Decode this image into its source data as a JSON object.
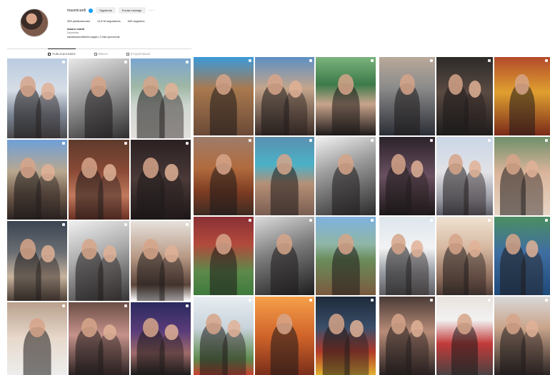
{
  "profile": {
    "username": "mauroicardi",
    "verified_icon": "verified-badge-icon",
    "follow_label": "Siguiendo",
    "message_label": "Enviar mensaje",
    "more_label": "···",
    "stats": {
      "posts": "383 publicaciones",
      "followers": "11,8 M seguidores",
      "following": "540 seguidos"
    },
    "name": "mauro icardi",
    "category": "Deportista",
    "bio": "wandanaracollection.pages | 2 links oprovechar"
  },
  "tabs": [
    {
      "label": "PUBLICACIONES",
      "icon": "grid-icon",
      "active": true
    },
    {
      "label": "REELS",
      "icon": "reels-icon",
      "active": false
    },
    {
      "label": "ETIQUETADAS",
      "icon": "tagged-icon",
      "active": false
    }
  ],
  "colors": {
    "accent": "#0095f6",
    "border": "#dbdbdb",
    "button_bg": "#efefef"
  },
  "grid_a": [
    {
      "bg": "linear-gradient(180deg,#b9cbe0 0%,#d7dde6 40%,#7d8794 70%,#4b4a4d 100%)",
      "people": 2
    },
    {
      "bg": "linear-gradient(160deg,#e8e8e8 0%,#9a9a9a 45%,#2e2e2e 100%)",
      "people": 1
    },
    {
      "bg": "linear-gradient(180deg,#7aa6d1 0%,#9fb7a5 35%,#cfd6d0 60%,#e3e0dc 100%)",
      "people": 2
    },
    {
      "bg": "linear-gradient(180deg,#6fa0d8 0%,#b9a78e 40%,#6e5a4b 70%,#2c2522 100%)",
      "people": 2
    },
    {
      "bg": "linear-gradient(180deg,#5d3b2c 0%,#8a4a36 40%,#c27a5d 70%,#6a2f22 100%)",
      "people": 2
    },
    {
      "bg": "linear-gradient(180deg,#2b2022 0%,#4a3a38 50%,#1c1617 100%)",
      "people": 2
    },
    {
      "bg": "linear-gradient(180deg,#3a4552 0%,#6b6f73 40%,#c8b39d 70%,#4c3f37 100%)",
      "people": 2
    },
    {
      "bg": "linear-gradient(160deg,#f0f0f0 0%,#a8a8a8 45%,#353535 100%)",
      "people": 2
    },
    {
      "bg": "linear-gradient(180deg,#e6e1dc 0%,#b89985 45%,#5a443a 80%,#ffffff 100%)",
      "people": 2
    },
    {
      "bg": "linear-gradient(180deg,#b9a08c 0%,#e7d9cc 50%,#ededed 100%)",
      "people": 1
    },
    {
      "bg": "linear-gradient(180deg,#6b4e45 0%,#c5928a 45%,#2d2323 100%)",
      "people": 2
    },
    {
      "bg": "linear-gradient(180deg,#2a2a5e 0%,#5b3c7a 40%,#a06a6a 70%,#1b1b1b 100%)",
      "people": 2
    }
  ],
  "grid_b": [
    {
      "bg": "linear-gradient(180deg,#3a9ad9 0%,#a9794f 40%,#6b4a37 100%)",
      "people": 1
    },
    {
      "bg": "linear-gradient(180deg,#5d8fc4 0%,#c4a58b 40%,#3a2c28 100%)",
      "people": 2
    },
    {
      "bg": "linear-gradient(180deg,#7bb37c 0%,#3d7a4a 35%,#c8a48c 60%,#1f1a1a 100%)",
      "people": 1
    },
    {
      "bg": "linear-gradient(180deg,#9d7c6a 0%,#b26b3e 40%,#7d3c22 70%,#3c2a22 100%)",
      "people": 1
    },
    {
      "bg": "linear-gradient(180deg,#5b8fb0 0%,#4bb1c7 35%,#b58f76 60%,#7a5e52 100%)",
      "people": 1
    },
    {
      "bg": "linear-gradient(160deg,#f2f2f2 0%,#9b9b9b 40%,#2b2b2b 100%)",
      "people": 1
    },
    {
      "bg": "linear-gradient(180deg,#8a2f35 0%,#b24a3c 35%,#5c8a4b 70%,#3f7a3d 100%)",
      "people": 1
    },
    {
      "bg": "linear-gradient(160deg,#dcdcdc 0%,#7a7a7a 45%,#1e1e1e 100%)",
      "people": 1
    },
    {
      "bg": "linear-gradient(180deg,#7fb2e0 0%,#8fb6a6 35%,#6a8c5a 55%,#7a5a3e 100%)",
      "people": 1
    },
    {
      "bg": "linear-gradient(180deg,#e8eef2 0%,#c9d3db 40%,#5d8a4d 80%,#c9402f 100%)",
      "people": 2
    },
    {
      "bg": "linear-gradient(180deg,#f5a04a 0%,#d1642a 50%,#7a2e1a 100%)",
      "people": 1
    },
    {
      "bg": "linear-gradient(180deg,#1e2a3a 0%,#3a4f6a 40%,#b23a2a 70%,#e0b030 100%)",
      "people": 2
    }
  ],
  "grid_c": [
    {
      "bg": "linear-gradient(180deg,#b9a99a 0%,#8a8a8a 40%,#2c2e36 100%)",
      "people": 1
    },
    {
      "bg": "linear-gradient(180deg,#2c2a28 0%,#5a4a42 45%,#1d1c1c 100%)",
      "people": 2
    },
    {
      "bg": "linear-gradient(180deg,#b24a2a 0%,#e0a030 45%,#7a2a1a 100%)",
      "people": 1
    },
    {
      "bg": "linear-gradient(180deg,#2b2229 0%,#6a5060 50%,#1c1719 100%)",
      "people": 2
    },
    {
      "bg": "linear-gradient(180deg,#c9d6e6 0%,#e2e2e6 45%,#9a9aa4 80%,#5b5b64 100%)",
      "people": 2
    },
    {
      "bg": "linear-gradient(180deg,#6f8f6a 0%,#d9b49a 45%,#e8d6c6 100%)",
      "people": 2
    },
    {
      "bg": "linear-gradient(180deg,#dde6ee 0%,#f2f2f2 40%,#9a9fa6 70%,#5e5e60 100%)",
      "people": 2
    },
    {
      "bg": "linear-gradient(180deg,#efe2d2 0%,#d6b8a0 40%,#8a6a5a 80%,#4e3d35 100%)",
      "people": 2
    },
    {
      "bg": "linear-gradient(180deg,#4c8f62 0%,#3f6ea0 45%,#1f4a7a 100%)",
      "people": 2
    },
    {
      "bg": "linear-gradient(180deg,#4a3a36 0%,#b88c78 45%,#2a2222 100%)",
      "people": 2
    },
    {
      "bg": "linear-gradient(180deg,#e8e2dc 0%,#f2f2f2 30%,#c23a3a 60%,#4a4242 100%)",
      "people": 1
    },
    {
      "bg": "linear-gradient(180deg,#d8d8d8 0%,#c9a48a 40%,#2a2323 100%)",
      "people": 2
    }
  ]
}
